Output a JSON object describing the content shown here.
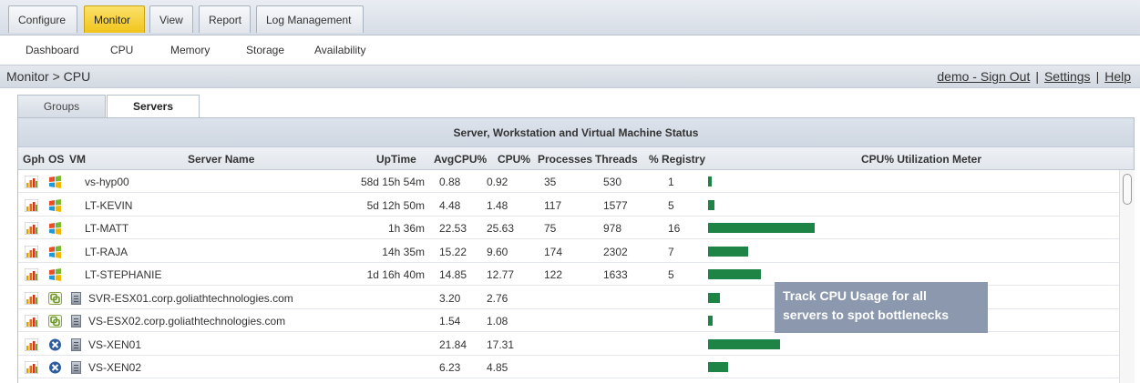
{
  "top_tabs": [
    {
      "label": "Configure"
    },
    {
      "label": "Monitor"
    },
    {
      "label": "View"
    },
    {
      "label": "Report"
    },
    {
      "label": "Log Management"
    }
  ],
  "active_top_tab": "Monitor",
  "sub_nav": [
    {
      "label": "Dashboard"
    },
    {
      "label": "CPU"
    },
    {
      "label": "Memory"
    },
    {
      "label": "Storage"
    },
    {
      "label": "Availability"
    }
  ],
  "breadcrumb": "Monitor > CPU",
  "user_links": {
    "signout": "demo - Sign Out",
    "settings": "Settings",
    "help": "Help",
    "separator": "|"
  },
  "inner_tabs": [
    {
      "label": "Groups"
    },
    {
      "label": "Servers"
    }
  ],
  "active_inner_tab": "Servers",
  "grid": {
    "title": "Server, Workstation and Virtual Machine Status",
    "columns": {
      "gph": "Gph",
      "os": "OS",
      "vm": "VM",
      "name": "Server Name",
      "uptime": "UpTime",
      "avgcpu": "AvgCPU%",
      "cpu": "CPU%",
      "processes": "Processes",
      "threads": "Threads",
      "registry": "% Registry",
      "meter": "CPU% Utilization Meter"
    },
    "rows": [
      {
        "os": "windows-logo-icon",
        "vm": false,
        "name": "vs-hyp00",
        "uptime": "58d 15h 54m",
        "avgcpu": "0.88",
        "cpu": "0.92",
        "processes": "35",
        "threads": "530",
        "registry": "1",
        "meter_cpu": 0.92
      },
      {
        "os": "windows-logo-icon",
        "vm": false,
        "name": "LT-KEVIN",
        "uptime": "5d 12h 50m",
        "avgcpu": "4.48",
        "cpu": "1.48",
        "processes": "117",
        "threads": "1577",
        "registry": "5",
        "meter_cpu": 1.48
      },
      {
        "os": "windows-logo-icon",
        "vm": false,
        "name": "LT-MATT",
        "uptime": "1h 36m",
        "avgcpu": "22.53",
        "cpu": "25.63",
        "processes": "75",
        "threads": "978",
        "registry": "16",
        "meter_cpu": 25.63
      },
      {
        "os": "windows-logo-icon",
        "vm": false,
        "name": "LT-RAJA",
        "uptime": "14h 35m",
        "avgcpu": "15.22",
        "cpu": "9.60",
        "processes": "174",
        "threads": "2302",
        "registry": "7",
        "meter_cpu": 9.6
      },
      {
        "os": "windows-logo-icon",
        "vm": false,
        "name": "LT-STEPHANIE",
        "uptime": "1d 16h 40m",
        "avgcpu": "14.85",
        "cpu": "12.77",
        "processes": "122",
        "threads": "1633",
        "registry": "5",
        "meter_cpu": 12.77
      },
      {
        "os": "vmware-logo-icon",
        "vm": true,
        "name": "SVR-ESX01.corp.goliathtechnologies.com",
        "uptime": "",
        "avgcpu": "3.20",
        "cpu": "2.76",
        "processes": "",
        "threads": "",
        "registry": "",
        "meter_cpu": 2.76
      },
      {
        "os": "vmware-logo-icon",
        "vm": true,
        "name": "VS-ESX02.corp.goliathtechnologies.com",
        "uptime": "",
        "avgcpu": "1.54",
        "cpu": "1.08",
        "processes": "",
        "threads": "",
        "registry": "",
        "meter_cpu": 1.08
      },
      {
        "os": "xen-logo-icon",
        "vm": true,
        "name": "VS-XEN01",
        "uptime": "",
        "avgcpu": "21.84",
        "cpu": "17.31",
        "processes": "",
        "threads": "",
        "registry": "",
        "meter_cpu": 17.31
      },
      {
        "os": "xen-logo-icon",
        "vm": true,
        "name": "VS-XEN02",
        "uptime": "",
        "avgcpu": "6.23",
        "cpu": "4.85",
        "processes": "",
        "threads": "",
        "registry": "",
        "meter_cpu": 4.85
      }
    ]
  },
  "callout": {
    "line1": "Track CPU Usage for all",
    "line2": "servers to spot bottlenecks"
  },
  "colors": {
    "meter_bar": "#1e8446",
    "active_tab": "#f2c51b",
    "callout_bg": "#8b98ad"
  }
}
